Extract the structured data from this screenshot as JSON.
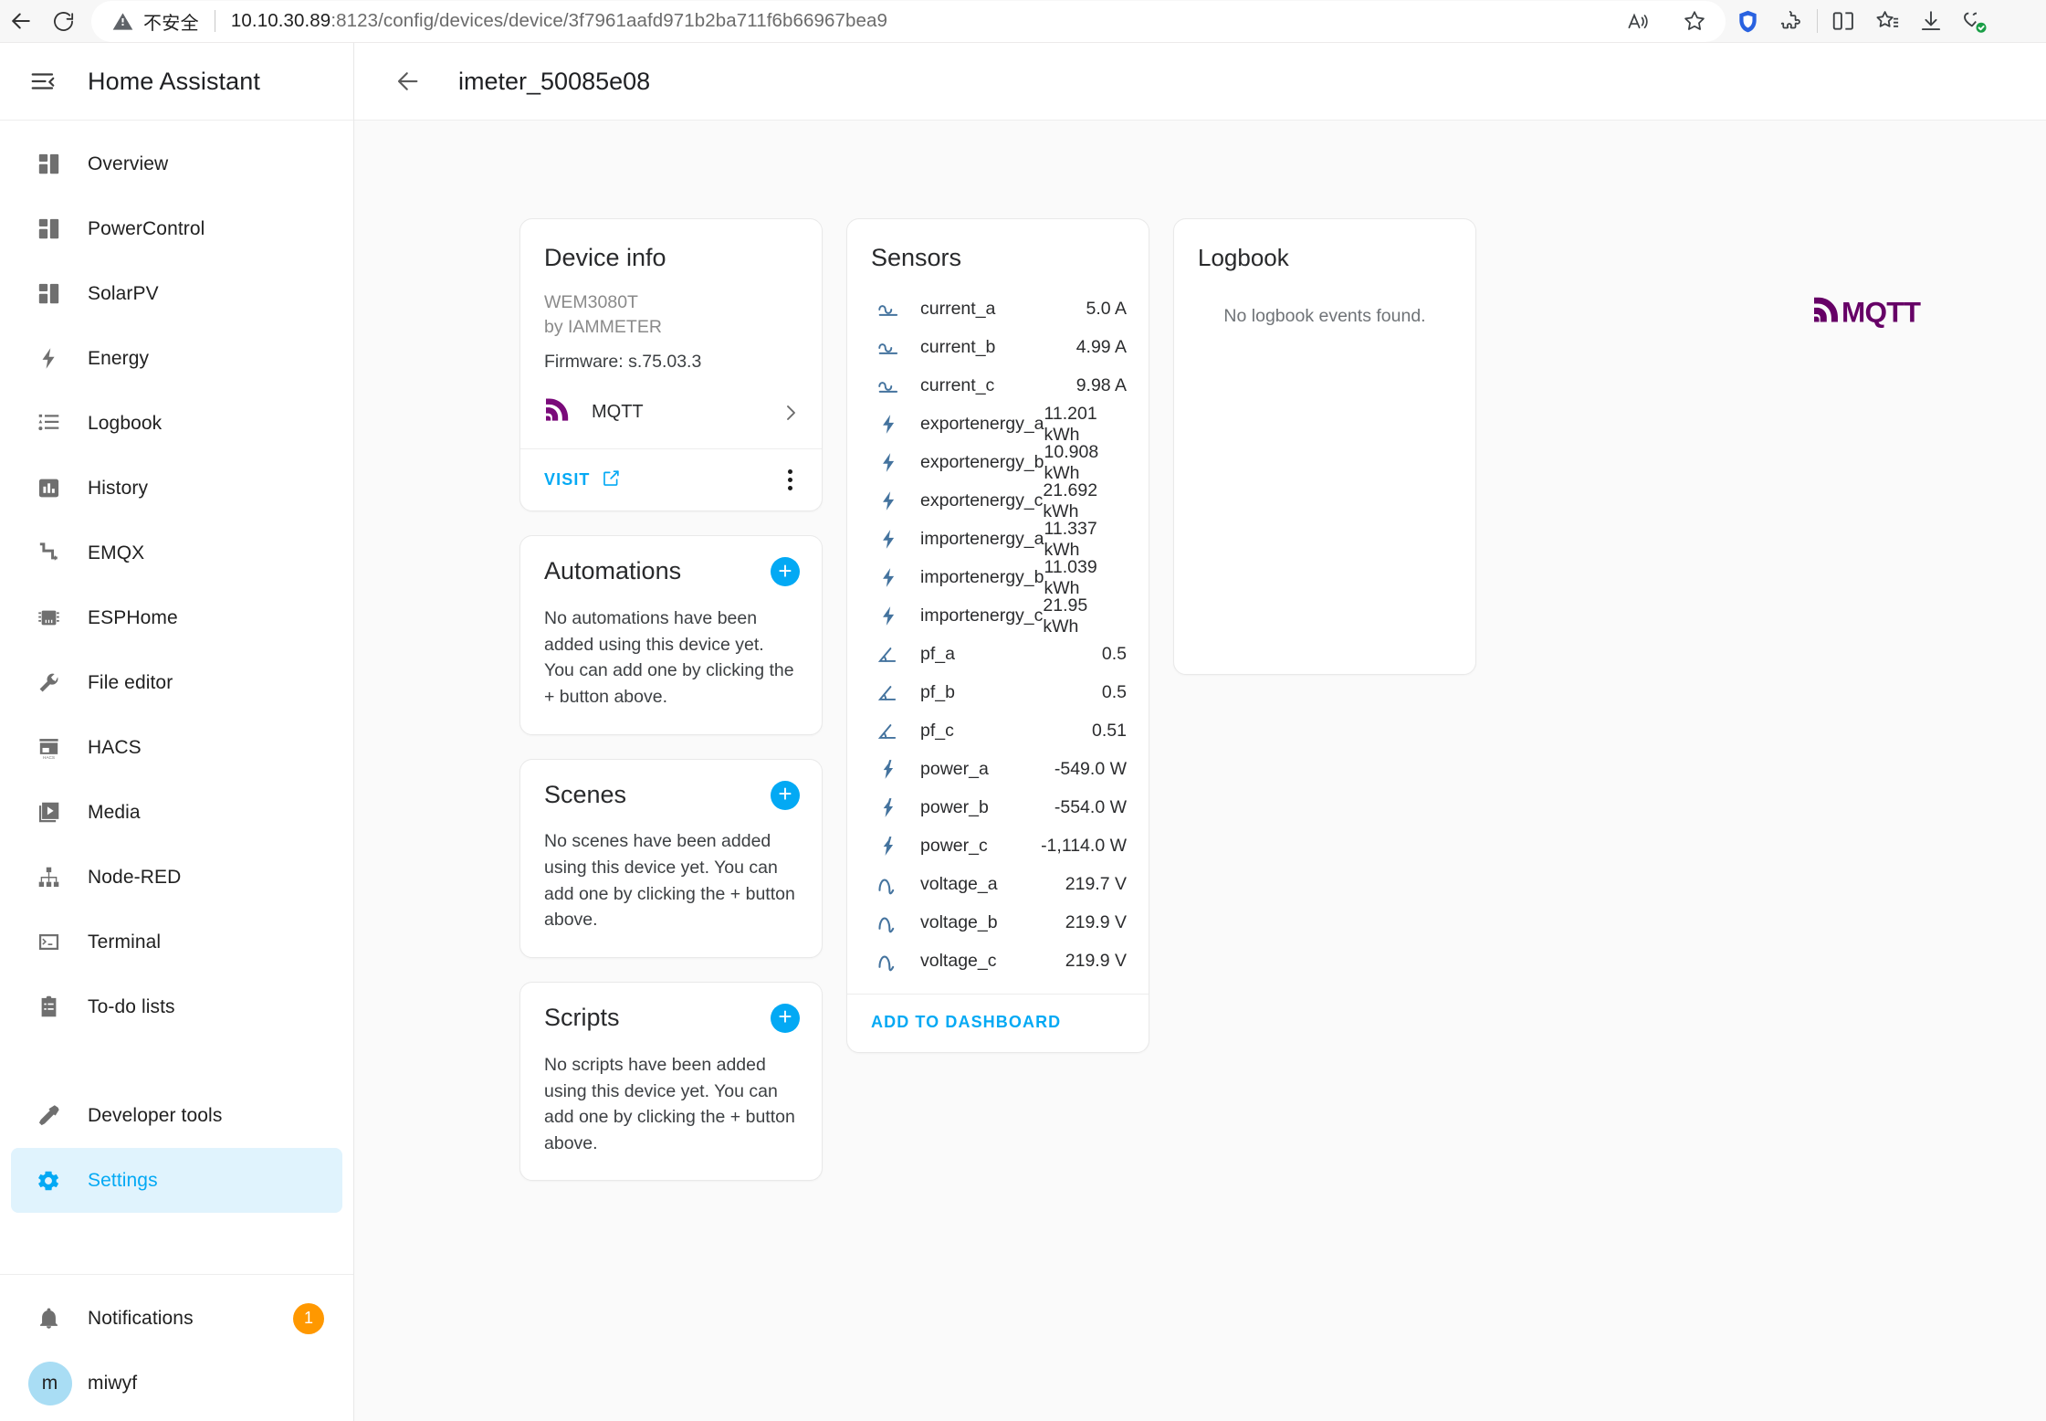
{
  "browser": {
    "back_icon": "back-arrow-icon",
    "reload_icon": "reload-icon",
    "security_label": "不安全",
    "url_host": "10.10.30.89",
    "url_rest": ":8123/config/devices/device/3f7961aafd971b2ba711f6b66967bea9",
    "toolbar_icons": [
      "read-aloud-icon",
      "favorite-star-icon",
      "shield-extension-icon",
      "extensions-puzzle-icon",
      "split-screen-icon",
      "collections-icon",
      "downloads-icon",
      "browser-essentials-icon"
    ]
  },
  "sidebar": {
    "title": "Home Assistant",
    "menu_icon": "collapse-menu-icon",
    "items": [
      {
        "label": "Overview",
        "icon": "dashboard-tiles-icon"
      },
      {
        "label": "PowerControl",
        "icon": "dashboard-tiles-icon"
      },
      {
        "label": "SolarPV",
        "icon": "dashboard-tiles-icon"
      },
      {
        "label": "Energy",
        "icon": "lightning-bolt-icon"
      },
      {
        "label": "Logbook",
        "icon": "format-list-icon"
      },
      {
        "label": "History",
        "icon": "chart-bar-icon"
      },
      {
        "label": "EMQX",
        "icon": "transit-connection-icon"
      },
      {
        "label": "ESPHome",
        "icon": "chip-icon"
      },
      {
        "label": "File editor",
        "icon": "wrench-icon"
      },
      {
        "label": "HACS",
        "icon": "store-icon"
      },
      {
        "label": "Media",
        "icon": "play-box-multiple-icon"
      },
      {
        "label": "Node-RED",
        "icon": "sitemap-icon"
      },
      {
        "label": "Terminal",
        "icon": "console-icon"
      },
      {
        "label": "To-do lists",
        "icon": "clipboard-list-icon"
      }
    ],
    "developer_tools": {
      "label": "Developer tools",
      "icon": "hammer-icon"
    },
    "settings": {
      "label": "Settings",
      "icon": "gear-icon",
      "active": true
    },
    "notifications": {
      "label": "Notifications",
      "icon": "bell-icon",
      "count": "1"
    },
    "user": {
      "label": "miwyf",
      "initial": "m"
    },
    "accent": "#03a9f4",
    "badge_color": "#ff9800"
  },
  "header": {
    "back_icon": "back-arrow-icon",
    "title": "imeter_50085e08"
  },
  "brand": {
    "logo_text": "MQTT",
    "color": "#660066"
  },
  "device_info": {
    "title": "Device info",
    "model": "WEM3080T",
    "manufacturer": "by IAMMETER",
    "firmware": "Firmware: s.75.03.3",
    "integration": {
      "name": "MQTT",
      "icon": "mqtt-logo-icon",
      "chevron": "chevron-right-icon"
    },
    "visit_label": "VISIT",
    "visit_icon": "open-in-new-icon",
    "menu_icon": "kebab-menu-icon"
  },
  "automations": {
    "title": "Automations",
    "add_icon": "plus-icon",
    "empty": "No automations have been added using this device yet. You can add one by clicking the + button above."
  },
  "scenes": {
    "title": "Scenes",
    "add_icon": "plus-icon",
    "empty": "No scenes have been added using this device yet. You can add one by clicking the + button above."
  },
  "scripts": {
    "title": "Scripts",
    "add_icon": "plus-icon",
    "empty": "No scripts have been added using this device yet. You can add one by clicking the + button above."
  },
  "sensors": {
    "title": "Sensors",
    "add_to_dashboard": "ADD TO DASHBOARD",
    "rows": [
      {
        "name": "current_a",
        "value": "5.0 A",
        "icon": "sine-wave-dc-icon"
      },
      {
        "name": "current_b",
        "value": "4.99 A",
        "icon": "sine-wave-dc-icon"
      },
      {
        "name": "current_c",
        "value": "9.98 A",
        "icon": "sine-wave-dc-icon"
      },
      {
        "name": "exportenergy_a",
        "value": "11.201 kWh",
        "icon": "lightning-bolt-icon"
      },
      {
        "name": "exportenergy_b",
        "value": "10.908 kWh",
        "icon": "lightning-bolt-icon"
      },
      {
        "name": "exportenergy_c",
        "value": "21.692 kWh",
        "icon": "lightning-bolt-icon"
      },
      {
        "name": "importenergy_a",
        "value": "11.337 kWh",
        "icon": "lightning-bolt-icon"
      },
      {
        "name": "importenergy_b",
        "value": "11.039 kWh",
        "icon": "lightning-bolt-icon"
      },
      {
        "name": "importenergy_c",
        "value": "21.95 kWh",
        "icon": "lightning-bolt-icon"
      },
      {
        "name": "pf_a",
        "value": "0.5",
        "icon": "angle-acute-icon"
      },
      {
        "name": "pf_b",
        "value": "0.5",
        "icon": "angle-acute-icon"
      },
      {
        "name": "pf_c",
        "value": "0.51",
        "icon": "angle-acute-icon"
      },
      {
        "name": "power_a",
        "value": "-549.0 W",
        "icon": "flash-icon"
      },
      {
        "name": "power_b",
        "value": "-554.0 W",
        "icon": "flash-icon"
      },
      {
        "name": "power_c",
        "value": "-1,114.0 W",
        "icon": "flash-icon"
      },
      {
        "name": "voltage_a",
        "value": "219.7 V",
        "icon": "sine-wave-icon"
      },
      {
        "name": "voltage_b",
        "value": "219.9 V",
        "icon": "sine-wave-icon"
      },
      {
        "name": "voltage_c",
        "value": "219.9 V",
        "icon": "sine-wave-icon"
      }
    ]
  },
  "logbook": {
    "title": "Logbook",
    "empty": "No logbook events found."
  }
}
